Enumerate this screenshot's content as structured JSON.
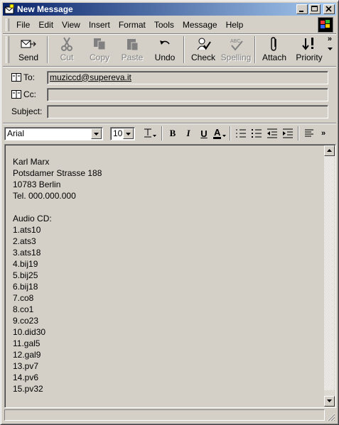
{
  "window": {
    "title": "New Message"
  },
  "menu": [
    "File",
    "Edit",
    "View",
    "Insert",
    "Format",
    "Tools",
    "Message",
    "Help"
  ],
  "toolbar": {
    "send": "Send",
    "cut": "Cut",
    "copy": "Copy",
    "paste": "Paste",
    "undo": "Undo",
    "check": "Check",
    "spelling": "Spelling",
    "attach": "Attach",
    "priority": "Priority",
    "more": "»"
  },
  "header": {
    "to_label": "To:",
    "to_value": "muziccd@supereva.it",
    "cc_label": "Cc:",
    "cc_value": "",
    "subject_label": "Subject:",
    "subject_value": ""
  },
  "format": {
    "font": "Arial",
    "size": "10",
    "bold": "B",
    "italic": "I",
    "underline": "U",
    "more": "»"
  },
  "body": {
    "text": "Karl Marx\nPotsdamer Strasse 188\n10783 Berlin\nTel. 000.000.000\n\nAudio CD:\n1.ats10\n2.ats3\n3.ats18\n4.bij19\n5.bij25\n6.bij18\n7.co8\n8.co1\n9.co23\n10.did30\n11.gal5\n12.gal9\n13.pv7\n14.pv6\n15.pv32"
  },
  "colors": {
    "title_start": "#0a246a",
    "title_end": "#a6caf0",
    "face": "#d4d0c8"
  }
}
